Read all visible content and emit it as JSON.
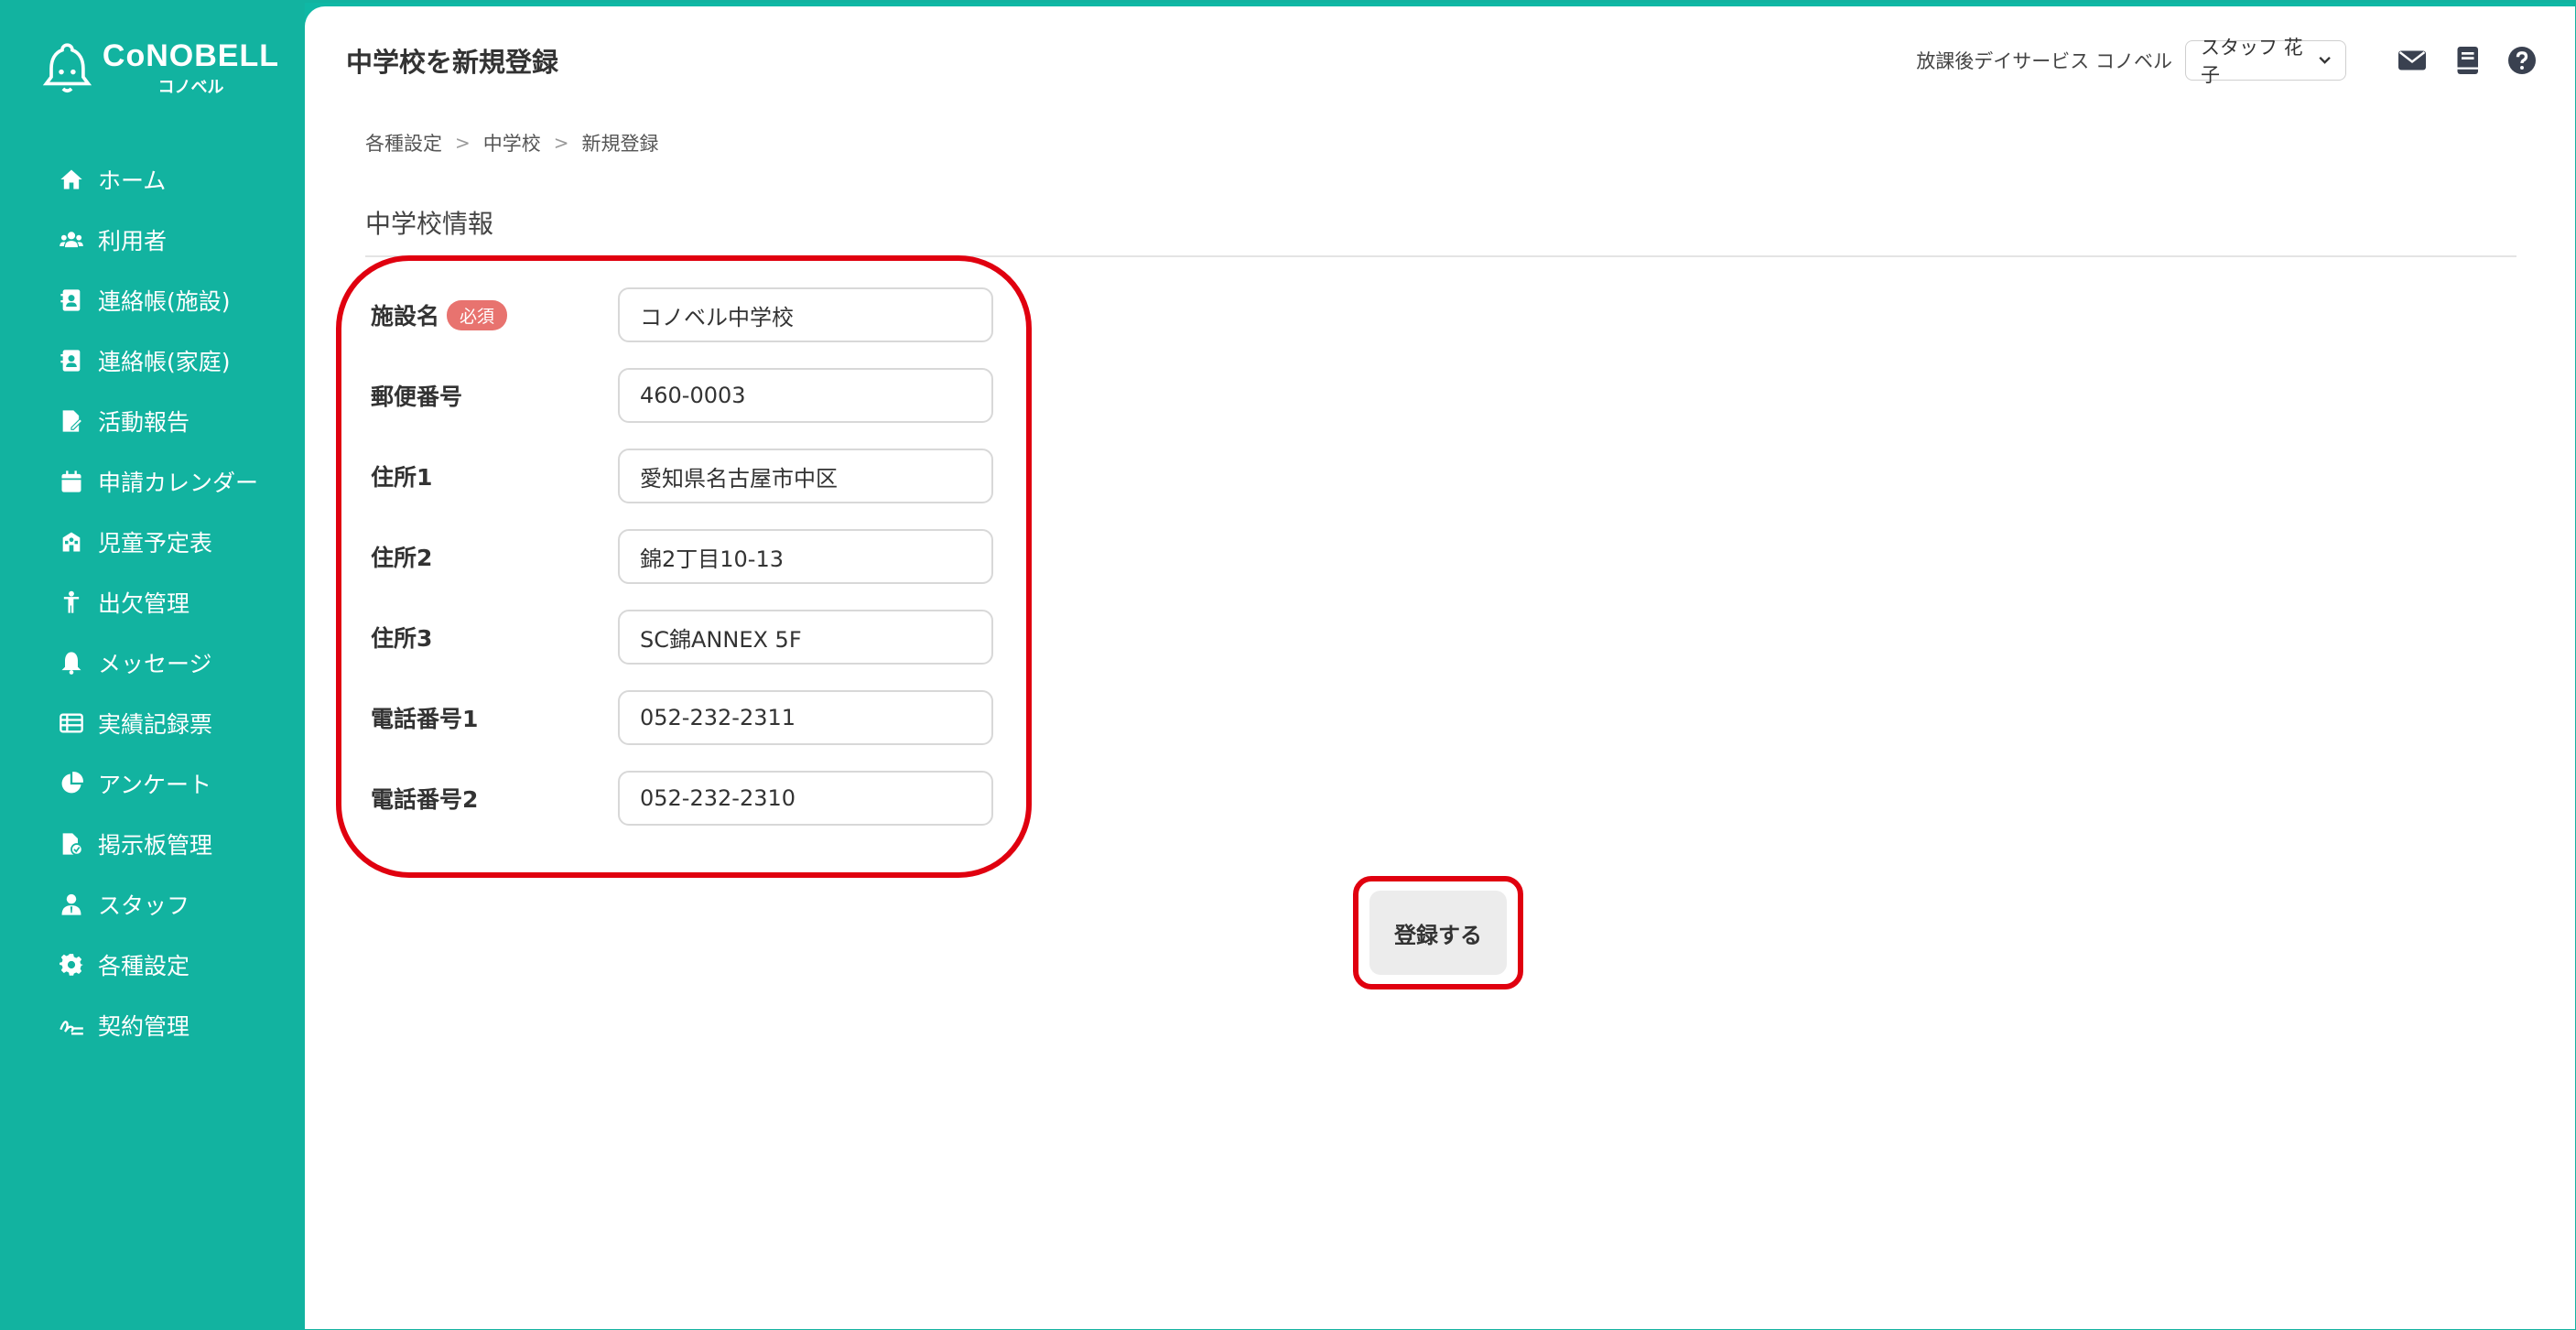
{
  "logo": {
    "main": "CoNOBELL",
    "sub": "コノベル"
  },
  "sidebar": {
    "items": [
      {
        "label": "ホーム",
        "icon": "home-icon"
      },
      {
        "label": "利用者",
        "icon": "users-icon"
      },
      {
        "label": "連絡帳(施設)",
        "icon": "contact-book-icon"
      },
      {
        "label": "連絡帳(家庭)",
        "icon": "contact-book-icon"
      },
      {
        "label": "活動報告",
        "icon": "file-edit-icon"
      },
      {
        "label": "申請カレンダー",
        "icon": "calendar-icon"
      },
      {
        "label": "児童予定表",
        "icon": "school-icon"
      },
      {
        "label": "出欠管理",
        "icon": "person-icon"
      },
      {
        "label": "メッセージ",
        "icon": "bell-icon"
      },
      {
        "label": "実績記録票",
        "icon": "table-icon"
      },
      {
        "label": "アンケート",
        "icon": "pie-chart-icon"
      },
      {
        "label": "掲示板管理",
        "icon": "file-check-icon"
      },
      {
        "label": "スタッフ",
        "icon": "staff-icon"
      },
      {
        "label": "各種設定",
        "icon": "gear-icon"
      },
      {
        "label": "契約管理",
        "icon": "signature-icon"
      }
    ]
  },
  "header": {
    "title": "中学校を新規登録",
    "facility": "放課後デイサービス コノベル",
    "staff": "スタッフ 花子"
  },
  "breadcrumb": [
    "各種設定",
    "中学校",
    "新規登録"
  ],
  "section": {
    "title": "中学校情報"
  },
  "form": {
    "required_badge": "必須",
    "fields": [
      {
        "label": "施設名",
        "value": "コノベル中学校",
        "required": true
      },
      {
        "label": "郵便番号",
        "value": "460-0003"
      },
      {
        "label": "住所1",
        "value": "愛知県名古屋市中区"
      },
      {
        "label": "住所2",
        "value": "錦2丁目10-13"
      },
      {
        "label": "住所3",
        "value": "SC錦ANNEX 5F"
      },
      {
        "label": "電話番号1",
        "value": "052-232-2311"
      },
      {
        "label": "電話番号2",
        "value": "052-232-2310"
      }
    ],
    "submit_label": "登録する"
  },
  "colors": {
    "brand": "#12b3a0",
    "highlight": "#e0000f",
    "badge": "#e8736f"
  }
}
